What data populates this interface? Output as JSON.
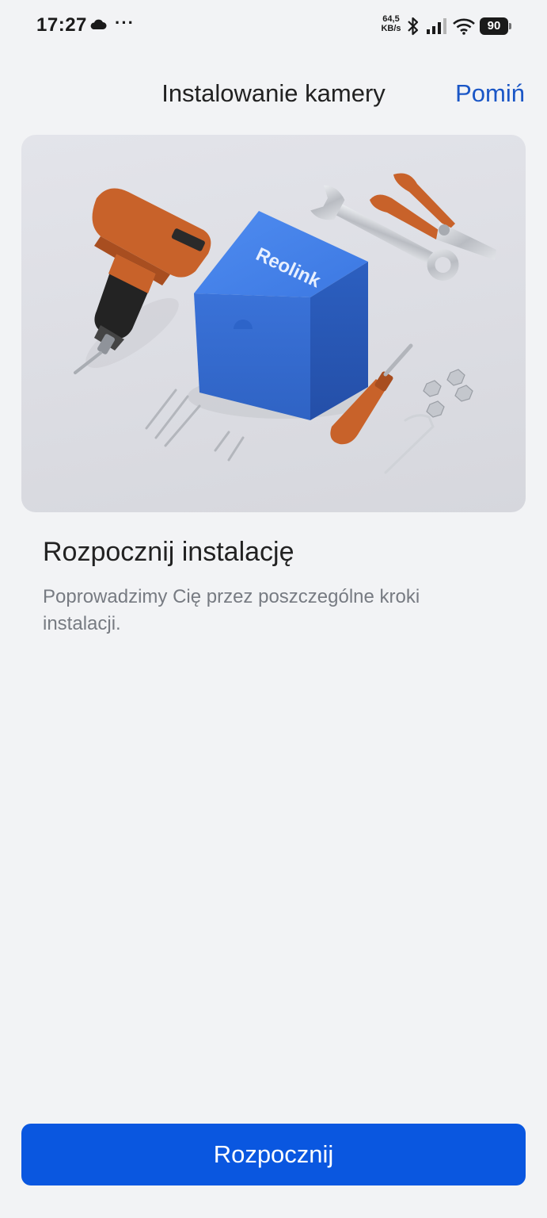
{
  "status_bar": {
    "time": "17:27",
    "dots": "···",
    "speed_value": "64,5",
    "speed_unit": "KB/s",
    "battery": "90",
    "icons": [
      "cloud-icon",
      "bluetooth-icon",
      "signal-icon",
      "wifi-icon",
      "battery-icon"
    ]
  },
  "header": {
    "title": "Instalowanie kamery",
    "skip_label": "Pomiń"
  },
  "hero": {
    "box_brand": "Reolink",
    "icon": "installation-tools-illustration"
  },
  "content": {
    "title": "Rozpocznij instalację",
    "description": "Poprowadzimy Cię przez poszczególne kroki instalacji."
  },
  "footer": {
    "start_label": "Rozpocznij"
  },
  "colors": {
    "accent": "#0a57e0",
    "link": "#1a56c6",
    "background": "#f2f3f5",
    "box_blue": "#3f7ee6",
    "tool_orange": "#c8622a"
  }
}
